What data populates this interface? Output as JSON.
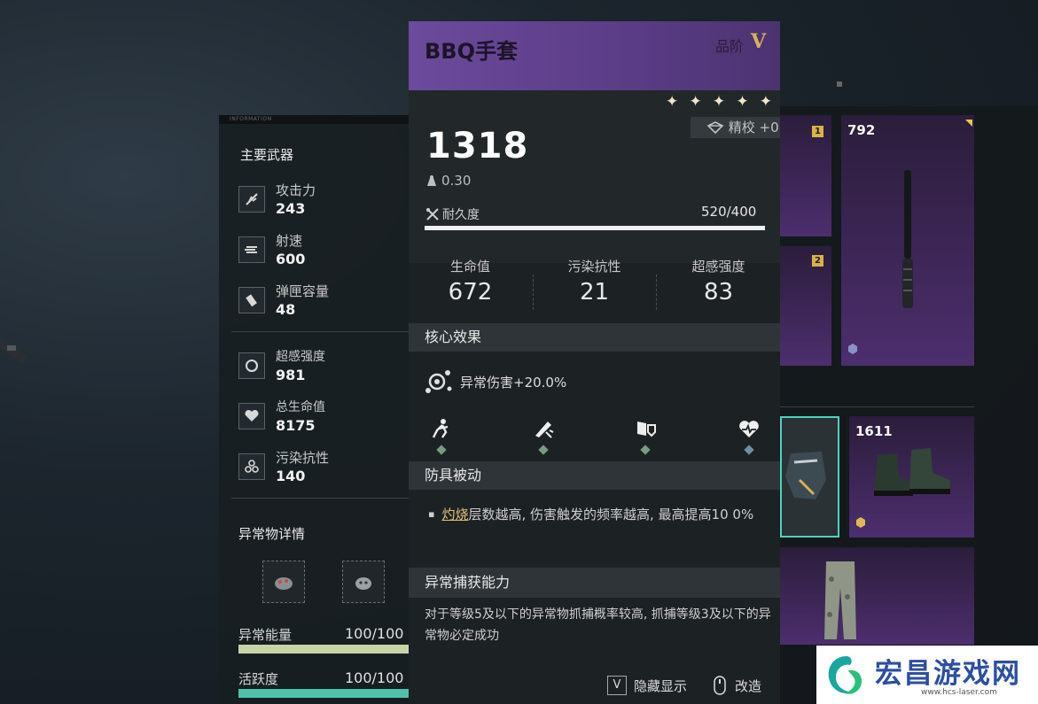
{
  "left_panel": {
    "topbar_text": "INFORMATION",
    "weapon_title": "主要武器",
    "weapon_stats": [
      {
        "label": "攻击力",
        "value": "243",
        "icon": "attack-icon"
      },
      {
        "label": "射速",
        "value": "600",
        "icon": "fire-rate-icon"
      },
      {
        "label": "弹匣容量",
        "value": "48",
        "icon": "magazine-icon"
      }
    ],
    "attribute_stats": [
      {
        "label": "超感强度",
        "value": "981",
        "icon": "psi-icon"
      },
      {
        "label": "总生命值",
        "value": "8175",
        "icon": "heart-icon"
      },
      {
        "label": "污染抗性",
        "value": "140",
        "icon": "biohazard-icon"
      }
    ],
    "anomaly_title": "异常物详情",
    "anomaly_energy": {
      "label": "异常能量",
      "value": "100/100",
      "fraction": 1.0
    },
    "activity": {
      "label": "活跃度",
      "value": "100/100",
      "fraction": 1.0
    }
  },
  "tooltip": {
    "name": "BBQ手套",
    "grade_label": "品阶",
    "grade_value": "V",
    "stars": [
      "✦",
      "✦",
      "✦",
      "✦",
      "✦"
    ],
    "refine_label": "精校 +0",
    "power": "1318",
    "weight": "0.30",
    "durability_label": "耐久度",
    "durability_value": "520/400",
    "durability_fraction": 1.0,
    "sub_stats": [
      {
        "label": "生命值",
        "value": "672"
      },
      {
        "label": "污染抗性",
        "value": "21"
      },
      {
        "label": "超感强度",
        "value": "83"
      }
    ],
    "core_title": "核心效果",
    "core_effect": "异常伤害+20.0%",
    "core_icons": [
      "running-figure-icon",
      "weapon-burst-icon",
      "flag-shield-icon",
      "heartbeat-icon"
    ],
    "passive_title": "防具被动",
    "passive_bullet": "▪",
    "passive_keyword": "灼烧",
    "passive_text": "层数越高, 伤害触发的频率越高, 最高提高10 0%",
    "capture_title": "异常捕获能力",
    "capture_text": "对于等级5及以下的异常物抓捕概率较高, 抓捕等级3及以下的异常物必定成功",
    "footer": {
      "hide_key": "V",
      "hide_label": "隐藏显示",
      "modify_label": "改造"
    }
  },
  "inventory": {
    "card_number_top": "792",
    "card_number_bottom": "1611",
    "rank_1": "1",
    "rank_2": "2"
  },
  "watermark": {
    "text": "宏昌游戏网",
    "url": "www.hcs-laser.com"
  }
}
